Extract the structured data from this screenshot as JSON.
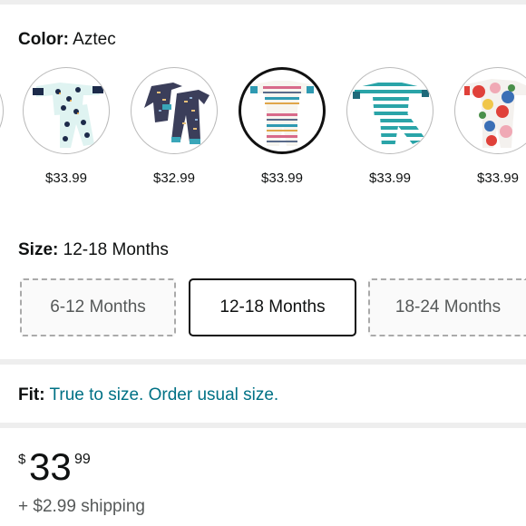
{
  "color": {
    "label": "Color:",
    "value": "Aztec"
  },
  "swatches": [
    {
      "name": "penguin",
      "price": "$33.99",
      "selected": false
    },
    {
      "name": "navy-print",
      "price": "$32.99",
      "selected": false
    },
    {
      "name": "aztec",
      "price": "$33.99",
      "selected": true
    },
    {
      "name": "teal-stripe",
      "price": "$33.99",
      "selected": false
    },
    {
      "name": "floral",
      "price": "$33.99",
      "selected": false
    }
  ],
  "size": {
    "label": "Size:",
    "value": "12-18 Months",
    "options": [
      {
        "label": "6-12 Months",
        "selected": false
      },
      {
        "label": "12-18 Months",
        "selected": true
      },
      {
        "label": "18-24 Months",
        "selected": false
      }
    ]
  },
  "fit": {
    "label": "Fit:",
    "value": "True to size. Order usual size."
  },
  "price": {
    "currency": "$",
    "whole": "33",
    "fraction": "99"
  },
  "shipping": "+ $2.99 shipping",
  "colors": {
    "link": "#007185",
    "divider": "#eeeeee"
  }
}
